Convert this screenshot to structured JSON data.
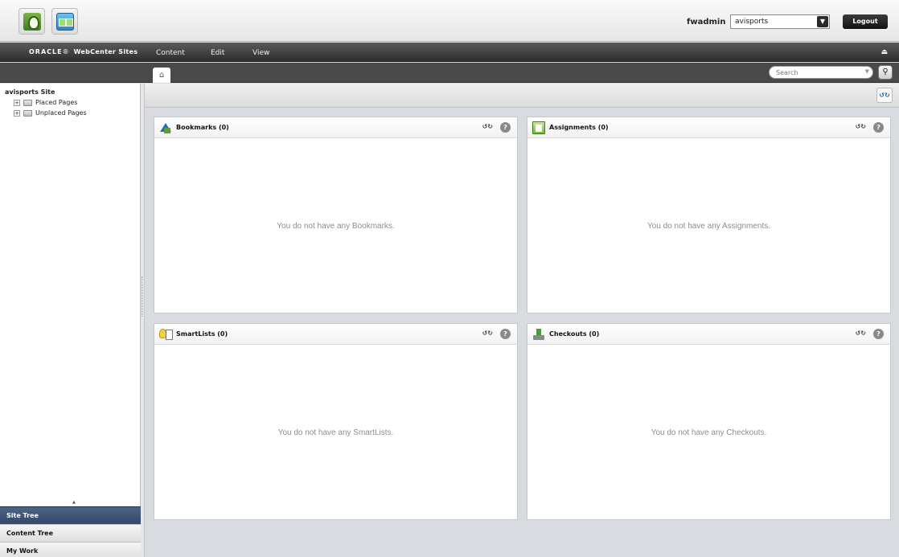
{
  "header": {
    "username": "fwadmin",
    "site_selected": "avisports",
    "logout_label": "Logout"
  },
  "menubar": {
    "brand_oracle": "ORACLE",
    "brand_product": "WebCenter Sites",
    "items": [
      "Content",
      "Edit",
      "View"
    ]
  },
  "tabbar": {
    "search_placeholder": "Search"
  },
  "sidebar": {
    "site_title": "avisports Site",
    "nodes": [
      "Placed Pages",
      "Unplaced Pages"
    ],
    "nav": [
      "Site Tree",
      "Content Tree",
      "My Work"
    ],
    "active_nav": "Site Tree"
  },
  "panels": [
    {
      "title": "Bookmarks (0)",
      "empty_text": "You do not have any Bookmarks.",
      "icon": "bookmark-icon"
    },
    {
      "title": "Assignments (0)",
      "empty_text": "You do not have any Assignments.",
      "icon": "clipboard-icon"
    },
    {
      "title": "SmartLists (0)",
      "empty_text": "You do not have any SmartLists.",
      "icon": "smartlist-icon"
    },
    {
      "title": "Checkouts (0)",
      "empty_text": "You do not have any Checkouts.",
      "icon": "checkout-icon"
    }
  ],
  "colors": {
    "active_nav_bg": "#3f5577",
    "menubar_bg": "#3a3a3a",
    "workspace_bg": "#d8dbe0"
  }
}
